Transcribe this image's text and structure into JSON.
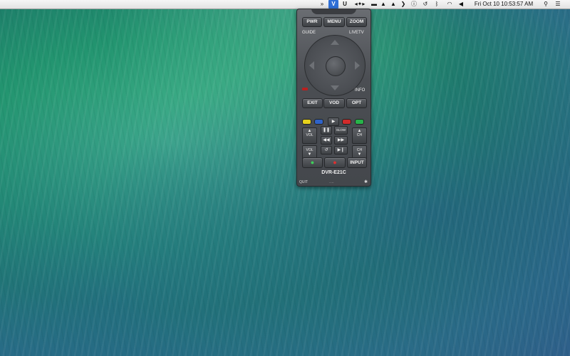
{
  "menubar": {
    "clock": "Fri Oct 10  10:53:57 AM",
    "icons": [
      "scripts-icon",
      "remote-app-icon",
      "u-icon",
      "arrows-icon",
      "battery-icon",
      "bell-icon",
      "notification-icon",
      "chevron-icon",
      "info-icon",
      "timemachine-icon",
      "bluetooth-icon",
      "wifi-icon",
      "volume-icon",
      "search-icon",
      "list-icon"
    ]
  },
  "remote": {
    "pwr": "PWR",
    "menu": "MENU",
    "zoom": "ZOOM",
    "guide": "GUIDE",
    "livetv": "LIVETV",
    "info": "INFO",
    "exit": "EXIT",
    "vod": "VOD",
    "opt": "OPT",
    "vol": "VOL",
    "ch": "CH",
    "slow": "SLOW",
    "input": "INPUT",
    "device": "DVR-E21C",
    "quit": "QUIT",
    "colors": {
      "yellow": "#e6d21c",
      "blue": "#2f63c8",
      "red": "#d12b2b",
      "green": "#27b34a"
    }
  }
}
